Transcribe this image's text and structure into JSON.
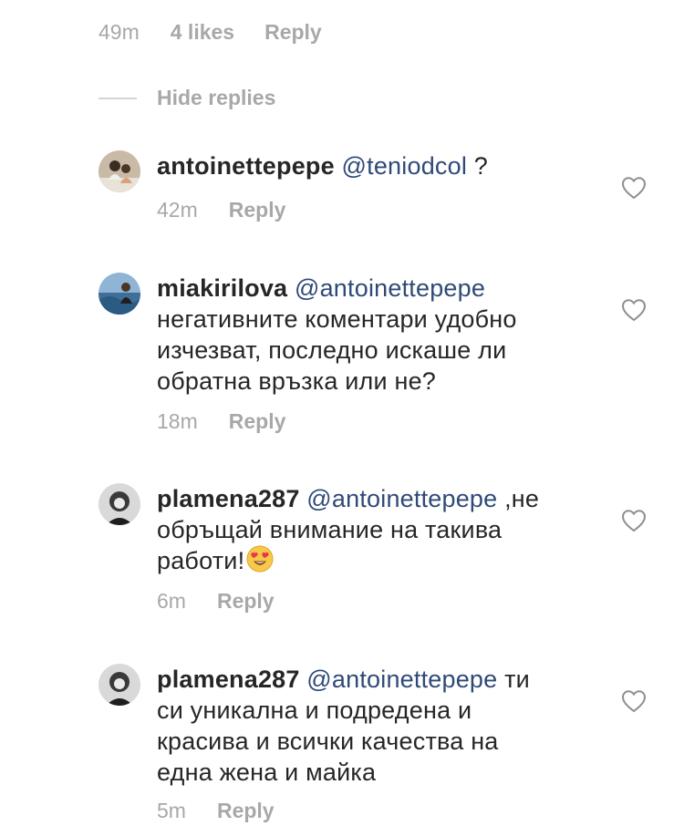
{
  "top_meta": {
    "time": "49m",
    "likes": "4 likes",
    "reply": "Reply"
  },
  "hide_replies": "Hide replies",
  "comments": [
    {
      "username": "antoinettepepe",
      "mention": "@teniodcol",
      "text_lines": [
        "?"
      ],
      "time": "42m",
      "reply": "Reply"
    },
    {
      "username": "miakirilova",
      "mention": "@antoinettepepe",
      "text_lines": [
        "негативните коментари удобно",
        "изчезват, последно искаше ли",
        "обратна връзка или не?"
      ],
      "time": "18m",
      "reply": "Reply"
    },
    {
      "username": "plamena287",
      "mention": "@antoinettepepe",
      "text_lines": [
        ",не",
        "обръщай внимание на такива",
        "работи!"
      ],
      "emoji": "heart-eyes",
      "time": "6m",
      "reply": "Reply"
    },
    {
      "username": "plamena287",
      "mention": "@antoinettepepe",
      "text_lines": [
        "ти",
        "си уникална и подредена и",
        "красива и всички качества на",
        "една жена и майка"
      ],
      "time": "5m",
      "reply": "Reply"
    }
  ],
  "icons": {
    "like": "heart-outline-icon",
    "emoji": "heart-eyes-emoji"
  },
  "colors": {
    "text": "#262626",
    "muted": "#a8a8a8",
    "mention": "#2f4a78"
  }
}
